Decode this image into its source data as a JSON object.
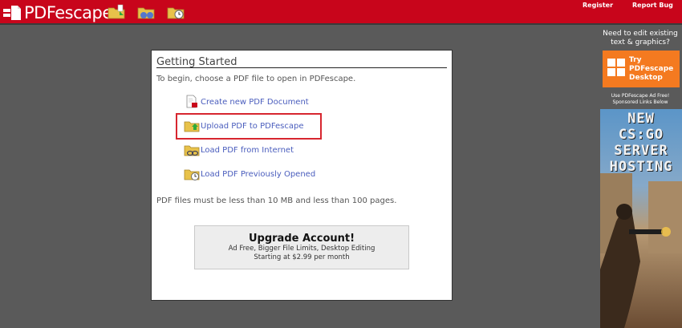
{
  "header": {
    "logo_text": "PDFescape",
    "links": {
      "register": "Register",
      "report_bug": "Report Bug"
    }
  },
  "panel": {
    "title": "Getting Started",
    "intro": "To begin, choose a PDF file to open in PDFescape.",
    "options": [
      {
        "label": "Create new PDF Document",
        "icon": "new-document-icon"
      },
      {
        "label": "Upload PDF to PDFescape",
        "icon": "upload-folder-icon"
      },
      {
        "label": "Load PDF from Internet",
        "icon": "internet-folder-icon"
      },
      {
        "label": "Load PDF Previously Opened",
        "icon": "history-folder-icon"
      }
    ],
    "limits": "PDF files must be less than 10 MB and less than 100 pages.",
    "upgrade": {
      "title": "Upgrade Account!",
      "line1": "Ad Free, Bigger File Limits, Desktop Editing",
      "line2": "Starting at $2.99 per month"
    }
  },
  "sidebar": {
    "need_line1": "Need to edit existing",
    "need_line2": "text & graphics?",
    "try_line1": "Try",
    "try_line2": "PDFescape",
    "try_line3": "Desktop",
    "adfree_line1": "Use PDFescape Ad Free!",
    "adfree_line2": "Sponsored Links Below",
    "ad_lines": [
      "NEW",
      "CS:GO",
      "SERVER",
      "HOSTING"
    ]
  },
  "colors": {
    "header_red": "#c8051b",
    "link_blue": "#4a5dbd",
    "highlight_red": "#d7262f",
    "desktop_orange": "#f47a20"
  }
}
